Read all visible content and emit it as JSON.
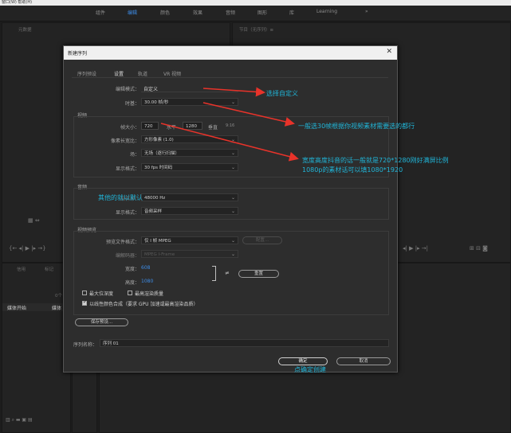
{
  "topbar": {
    "items": [
      "组件",
      "编辑",
      "颜色",
      "效果",
      "音频",
      "图形",
      "库",
      "Learning"
    ],
    "more": "»",
    "left_text": "窗口(W) 帮助(H)"
  },
  "panels": {
    "left_top_title": "元数据",
    "right_top_title": "节目（无序列）≡",
    "left_bottom_tabs": [
      "信用",
      "标记"
    ],
    "left_bottom_count": "0个",
    "left_bottom_header": [
      "媒体开始",
      "媒体"
    ]
  },
  "dialog": {
    "title": "新建序列",
    "close": "✕",
    "tabs": [
      "序列预设",
      "设置",
      "轨道",
      "VR 视频"
    ],
    "edit_mode_label": "编辑模式：",
    "edit_mode_value": "自定义",
    "timebase_label": "时基：",
    "timebase_value": "30.00 帧/秒",
    "video_section": "视频",
    "frame_size_label": "帧大小：",
    "frame_w": "720",
    "horiz_label": "水平",
    "frame_h": "1280",
    "vert_label": "垂直",
    "ratio": "9:16",
    "pixel_aspect_label": "像素长宽比：",
    "pixel_aspect_value": "方形像素 (1.0)",
    "field_label": "场：",
    "field_value": "无场（逐行扫描）",
    "display_format_label": "显示格式：",
    "display_format_value": "30 fps 时间码",
    "audio_section": "音频",
    "sample_rate_label": "采样率：",
    "sample_rate_value": "48000 Hz",
    "audio_display_label": "显示格式：",
    "audio_display_value": "音频采样",
    "preview_section": "视频预览",
    "preview_format_label": "预览文件格式：",
    "preview_format_value": "仅 I 帧 MPEG",
    "config_button": "配置...",
    "codec_label": "编解码器：",
    "codec_value": "MPEG I-Frame",
    "width_label": "宽度：",
    "width_value": "608",
    "height_label": "高度：",
    "height_value": "1080",
    "reset_button": "重置",
    "max_bit_depth": "最大位深度",
    "max_render_quality": "最高渲染质量",
    "linear_color": "以线性颜色合成（要求 GPU 加速或最高渲染品质）",
    "save_preset": "保存预设...",
    "seq_name_label": "序列名称：",
    "seq_name_value": "序列 01",
    "ok_button": "确定",
    "cancel_button": "取消"
  },
  "annotations": {
    "choose_custom": "选择自定义",
    "timebase_note": "一般选30帧根据你视频素材需要选的都行",
    "size_note_1": "宽度高度抖音的话一般就是720*1280刚好满屏比例",
    "size_note_2": "1080p的素材话可以填1080*1920",
    "others_default": "其他的就以默认",
    "ok_note": "点确定创建"
  },
  "colors": {
    "annotation": "#20b5d8",
    "arrow": "#e8332a",
    "accent": "#3d8ce6"
  }
}
